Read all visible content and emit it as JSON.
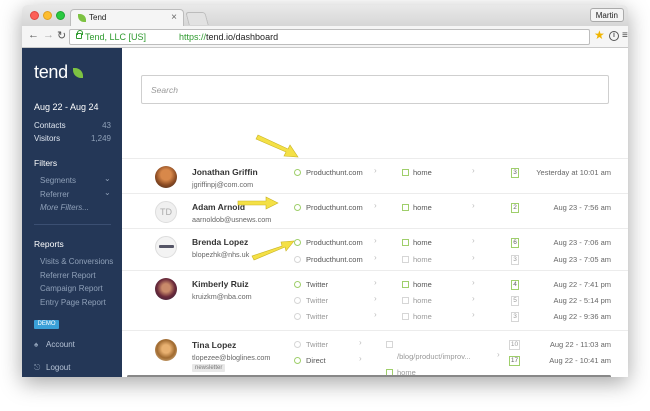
{
  "browser": {
    "tab_title": "Tend",
    "tab_close": "×",
    "profile_name": "Martin",
    "ev_cert": "Tend, LLC [US]",
    "url_scheme": "https://",
    "url_rest": "tend.io/dashboard",
    "back": "←",
    "forward": "→",
    "reload": "↻",
    "star": "★",
    "info": "i",
    "menu": "≡"
  },
  "sidebar": {
    "logo": "tend",
    "date_range": "Aug 22 -  Aug 24",
    "contacts_label": "Contacts",
    "contacts_value": "43",
    "visitors_label": "Visitors",
    "visitors_value": "1,249",
    "filters_heading": "Filters",
    "filter_items": [
      "Segments",
      "Referrer",
      "More Filters..."
    ],
    "caret": "⌄",
    "reports_heading": "Reports",
    "report_items": [
      "Visits & Conversions",
      "Referrer Report",
      "Campaign Report",
      "Entry Page Report"
    ],
    "demo_badge": "DEMO",
    "account_label": "Account",
    "logout_label": "Logout"
  },
  "search": {
    "placeholder": "Search"
  },
  "chevron": "›",
  "contacts": [
    {
      "name": "Jonathan Griffin",
      "email": "jgriffinpj@com.com",
      "avatar": "photo",
      "visits": [
        {
          "source": "Producthunt.com",
          "page": "home",
          "count": "3",
          "time": "Yesterday at 10:01 am",
          "dim": false
        }
      ]
    },
    {
      "name": "Adam Arnold",
      "email": "aarnoldob@usnews.com",
      "avatar": "TD",
      "visits": [
        {
          "source": "Producthunt.com",
          "page": "home",
          "count": "2",
          "time": "Aug 23 - 7:56 am",
          "dim": false
        }
      ]
    },
    {
      "name": "Brenda Lopez",
      "email": "blopezhk@nhs.uk",
      "avatar": "logo",
      "visits": [
        {
          "source": "Producthunt.com",
          "page": "home",
          "count": "6",
          "time": "Aug 23 - 7:06 am",
          "dim": false
        },
        {
          "source": "Producthunt.com",
          "page": "home",
          "count": "3",
          "time": "Aug 23 - 7:05 am",
          "dim": true
        }
      ]
    },
    {
      "name": "Kimberly Ruiz",
      "email": "kruizkm@nba.com",
      "avatar": "photo",
      "visits": [
        {
          "source": "Twitter",
          "page": "home",
          "count": "4",
          "time": "Aug 22 - 7:41 pm",
          "dim": false
        },
        {
          "source": "Twitter",
          "page": "home",
          "count": "5",
          "time": "Aug 22 - 5:14 pm",
          "dim": true
        },
        {
          "source": "Twitter",
          "page": "home",
          "count": "3",
          "time": "Aug 22 - 9:36 am",
          "dim": true
        }
      ]
    },
    {
      "name": "Tina Lopez",
      "email": "tlopezee@bloglines.com",
      "avatar": "photo",
      "tag": "newsletter",
      "visits": [
        {
          "source": "Twitter",
          "page": "/blog/product/improv...",
          "count": "10",
          "time": "Aug 22 - 11:03 am",
          "dim": true
        },
        {
          "source": "Direct",
          "page": "home",
          "count": "17",
          "time": "Aug 22 - 10:41 am",
          "dim": false
        }
      ]
    }
  ],
  "colors": {
    "sidebar": "#243757",
    "accent": "#7dc242",
    "annotation_arrow": "#f4e046"
  }
}
